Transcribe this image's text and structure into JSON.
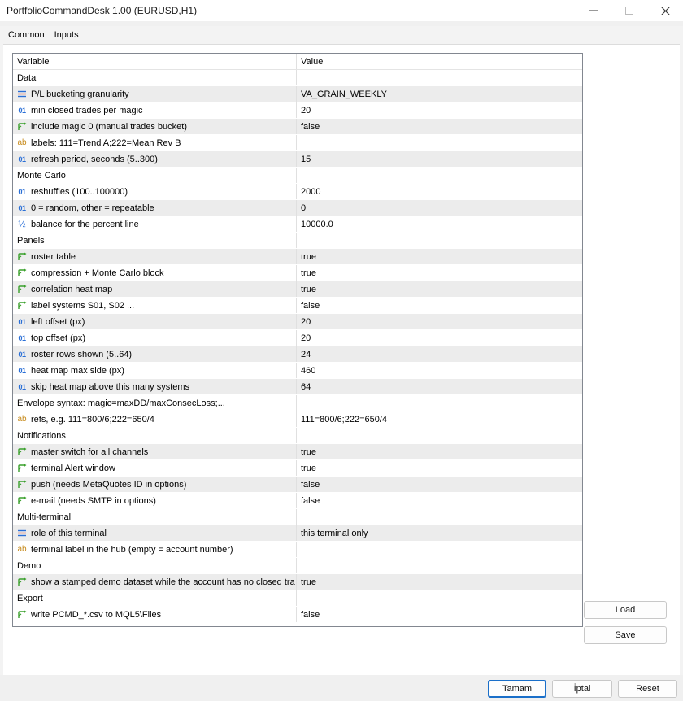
{
  "window": {
    "title": "PortfolioCommandDesk 1.00 (EURUSD,H1)"
  },
  "tabs": [
    {
      "label": "Common"
    },
    {
      "label": "Inputs"
    }
  ],
  "grid": {
    "header": {
      "variable": "Variable",
      "value": "Value"
    },
    "rows": [
      {
        "kind": "group",
        "label": "Data"
      },
      {
        "kind": "param",
        "icon": "enum-icon",
        "label": "P/L bucketing granularity",
        "value": "VA_GRAIN_WEEKLY"
      },
      {
        "kind": "param",
        "icon": "integer-icon",
        "label": "min closed trades per magic",
        "value": "20"
      },
      {
        "kind": "param",
        "icon": "bool-icon",
        "label": "include magic 0 (manual trades bucket)",
        "value": "false"
      },
      {
        "kind": "param",
        "icon": "string-icon",
        "label": "labels: 111=Trend A;222=Mean Rev B",
        "value": ""
      },
      {
        "kind": "param",
        "icon": "integer-icon",
        "label": "refresh period, seconds (5..300)",
        "value": "15"
      },
      {
        "kind": "group",
        "label": "Monte Carlo"
      },
      {
        "kind": "param",
        "icon": "integer-icon",
        "label": "reshuffles (100..100000)",
        "value": "2000"
      },
      {
        "kind": "param",
        "icon": "integer-icon",
        "label": "0 = random, other = repeatable",
        "value": "0"
      },
      {
        "kind": "param",
        "icon": "double-icon",
        "label": "balance for the percent line",
        "value": "10000.0"
      },
      {
        "kind": "group",
        "label": "Panels"
      },
      {
        "kind": "param",
        "icon": "bool-icon",
        "label": "roster table",
        "value": "true"
      },
      {
        "kind": "param",
        "icon": "bool-icon",
        "label": "compression + Monte Carlo block",
        "value": "true"
      },
      {
        "kind": "param",
        "icon": "bool-icon",
        "label": "correlation heat map",
        "value": "true"
      },
      {
        "kind": "param",
        "icon": "bool-icon",
        "label": "label systems S01, S02 ...",
        "value": "false"
      },
      {
        "kind": "param",
        "icon": "integer-icon",
        "label": "left offset (px)",
        "value": "20"
      },
      {
        "kind": "param",
        "icon": "integer-icon",
        "label": "top offset (px)",
        "value": "20"
      },
      {
        "kind": "param",
        "icon": "integer-icon",
        "label": "roster rows shown (5..64)",
        "value": "24"
      },
      {
        "kind": "param",
        "icon": "integer-icon",
        "label": "heat map max side (px)",
        "value": "460"
      },
      {
        "kind": "param",
        "icon": "integer-icon",
        "label": "skip heat map above this many systems",
        "value": "64"
      },
      {
        "kind": "group",
        "label": "Envelope   syntax: magic=maxDD/maxConsecLoss;..."
      },
      {
        "kind": "param",
        "icon": "string-icon",
        "label": "refs, e.g. 111=800/6;222=650/4",
        "value": "111=800/6;222=650/4"
      },
      {
        "kind": "group",
        "label": "Notifications"
      },
      {
        "kind": "param",
        "icon": "bool-icon",
        "label": "master switch for all channels",
        "value": "true"
      },
      {
        "kind": "param",
        "icon": "bool-icon",
        "label": "terminal Alert window",
        "value": "true"
      },
      {
        "kind": "param",
        "icon": "bool-icon",
        "label": "push (needs MetaQuotes ID in options)",
        "value": "false"
      },
      {
        "kind": "param",
        "icon": "bool-icon",
        "label": "e-mail (needs SMTP in options)",
        "value": "false"
      },
      {
        "kind": "group",
        "label": "Multi-terminal"
      },
      {
        "kind": "param",
        "icon": "enum-icon",
        "label": "role of this terminal",
        "value": "this terminal only"
      },
      {
        "kind": "param",
        "icon": "string-icon",
        "label": "terminal label in the hub (empty = account number)",
        "value": ""
      },
      {
        "kind": "group",
        "label": "Demo"
      },
      {
        "kind": "param",
        "icon": "bool-icon",
        "label": "show a stamped demo dataset while the account has no closed tra",
        "value": "true"
      },
      {
        "kind": "group",
        "label": "Export"
      },
      {
        "kind": "param",
        "icon": "bool-icon",
        "label": "write PCMD_*.csv to MQL5\\Files",
        "value": "false"
      }
    ]
  },
  "side_buttons": {
    "load": "Load",
    "save": "Save"
  },
  "dialog_buttons": {
    "ok": "Tamam",
    "cancel": "İptal",
    "reset": "Reset"
  },
  "icon_glyphs": {
    "integer-icon": "01",
    "string-icon": "ab",
    "double-icon": "½"
  },
  "colors": {
    "accent": "#1a6fc9",
    "stripe": "#ececec",
    "number_icon": "#2a6fd6",
    "bool_icon": "#3aa02c",
    "string_icon": "#c78a1b"
  }
}
